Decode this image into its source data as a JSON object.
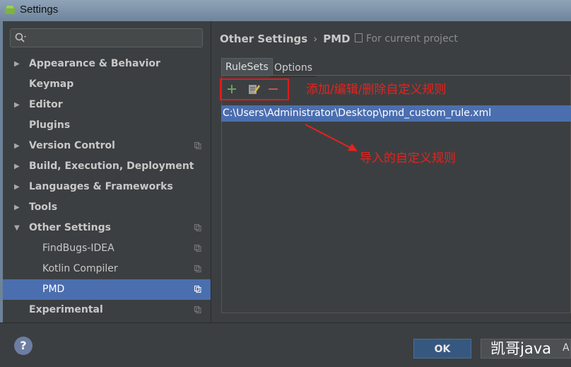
{
  "window": {
    "title": "Settings"
  },
  "sidebar": {
    "items": [
      {
        "label": "Appearance & Behavior",
        "arrow": "▶",
        "indent": "root",
        "copy": false,
        "selected": false
      },
      {
        "label": "Keymap",
        "arrow": "",
        "indent": "root",
        "copy": false,
        "selected": false
      },
      {
        "label": "Editor",
        "arrow": "▶",
        "indent": "root",
        "copy": false,
        "selected": false
      },
      {
        "label": "Plugins",
        "arrow": "",
        "indent": "root",
        "copy": false,
        "selected": false
      },
      {
        "label": "Version Control",
        "arrow": "▶",
        "indent": "root",
        "copy": true,
        "selected": false
      },
      {
        "label": "Build, Execution, Deployment",
        "arrow": "▶",
        "indent": "root",
        "copy": false,
        "selected": false
      },
      {
        "label": "Languages & Frameworks",
        "arrow": "▶",
        "indent": "root",
        "copy": false,
        "selected": false
      },
      {
        "label": "Tools",
        "arrow": "▶",
        "indent": "root",
        "copy": false,
        "selected": false
      },
      {
        "label": "Other Settings",
        "arrow": "▼",
        "indent": "root",
        "copy": true,
        "selected": false
      },
      {
        "label": "FindBugs-IDEA",
        "arrow": "",
        "indent": "child",
        "copy": true,
        "selected": false
      },
      {
        "label": "Kotlin Compiler",
        "arrow": "",
        "indent": "child",
        "copy": true,
        "selected": false
      },
      {
        "label": "PMD",
        "arrow": "",
        "indent": "child",
        "copy": true,
        "selected": true
      },
      {
        "label": "Experimental",
        "arrow": "",
        "indent": "root",
        "copy": true,
        "selected": false
      }
    ]
  },
  "breadcrumb": {
    "parent": "Other Settings",
    "separator": "›",
    "current": "PMD",
    "scope": "For current project"
  },
  "tabs": {
    "rulesets": "RuleSets",
    "options": "Options"
  },
  "toolbar": {
    "add_icon": "plus-icon",
    "edit_icon": "edit-icon",
    "remove_icon": "minus-icon"
  },
  "annotations": {
    "toolbar_note": "添加/编辑/删除自定义规则",
    "import_note": "导入的自定义规则"
  },
  "rules_list": [
    "C:\\Users\\Administrator\\Desktop\\pmd_custom_rule.xml"
  ],
  "footer": {
    "help": "?",
    "ok": "OK",
    "watermark": "凯哥java",
    "next_button_fragment": "A"
  },
  "colors": {
    "selection": "#4b6eaf",
    "annotation": "#e5231e",
    "background": "#3c3f41"
  }
}
